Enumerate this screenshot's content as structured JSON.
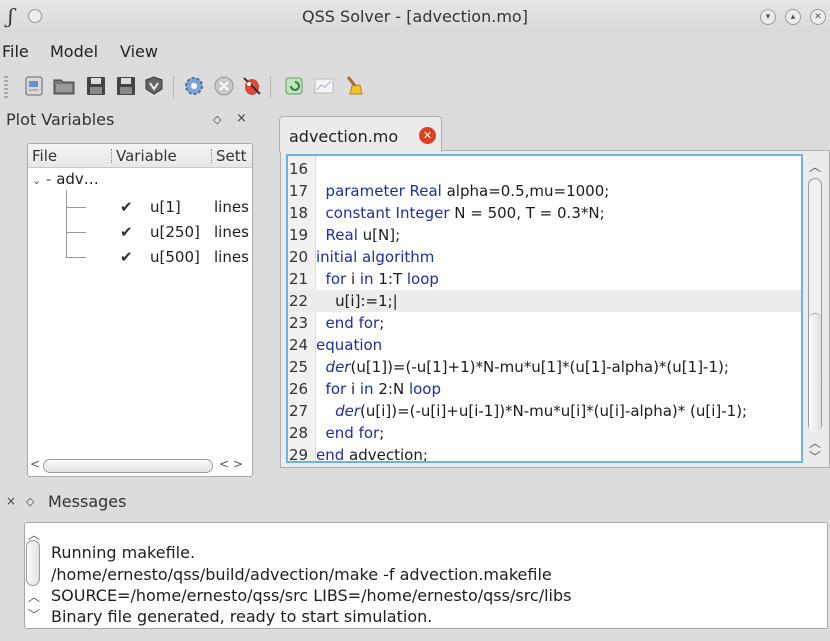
{
  "window": {
    "title": "QSS Solver - [advection.mo]",
    "app_glyph": "ʃ"
  },
  "menu": [
    "File",
    "Model",
    "View"
  ],
  "toolbar": {
    "buttons": [
      "new-file-icon",
      "open-folder-icon",
      "save-icon",
      "save-as-icon",
      "compile-icon",
      "settings-gear-icon",
      "stop-icon",
      "debug-icon",
      "run-icon",
      "plot-icon",
      "clear-broom-icon"
    ]
  },
  "plot_dock": {
    "title": "Plot Variables",
    "columns": [
      "File",
      "Variable",
      "Sett"
    ],
    "root_label": "adv…",
    "items": [
      {
        "variable": "u[1]",
        "setting": "lines"
      },
      {
        "variable": "u[250]",
        "setting": "lines"
      },
      {
        "variable": "u[500]",
        "setting": "lines"
      }
    ]
  },
  "editor": {
    "tab_label": "advection.mo",
    "lines": [
      {
        "n": "16",
        "parts": []
      },
      {
        "n": "17",
        "parts": [
          {
            "t": "  "
          },
          {
            "t": "parameter Real",
            "c": "kw"
          },
          {
            "t": " alpha=0.5,mu=1000;"
          }
        ]
      },
      {
        "n": "18",
        "parts": [
          {
            "t": "  "
          },
          {
            "t": "constant Integer",
            "c": "kw"
          },
          {
            "t": " N = 500, T = 0.3*N;"
          }
        ]
      },
      {
        "n": "19",
        "parts": [
          {
            "t": "  "
          },
          {
            "t": "Real",
            "c": "kw"
          },
          {
            "t": " u[N];"
          }
        ]
      },
      {
        "n": "20",
        "parts": [
          {
            "t": "initial algorithm",
            "c": "kw"
          }
        ]
      },
      {
        "n": "21",
        "parts": [
          {
            "t": "  "
          },
          {
            "t": "for",
            "c": "kw"
          },
          {
            "t": " i "
          },
          {
            "t": "in",
            "c": "kw"
          },
          {
            "t": " 1:T "
          },
          {
            "t": "loop",
            "c": "kw"
          }
        ]
      },
      {
        "n": "22",
        "parts": [
          {
            "t": "    u[i]:=1;|"
          }
        ],
        "current": true
      },
      {
        "n": "23",
        "parts": [
          {
            "t": "  "
          },
          {
            "t": "end for",
            "c": "kw"
          },
          {
            "t": ";"
          }
        ]
      },
      {
        "n": "24",
        "parts": [
          {
            "t": "equation",
            "c": "kw"
          }
        ]
      },
      {
        "n": "25",
        "parts": [
          {
            "t": "  "
          },
          {
            "t": "der",
            "c": "it"
          },
          {
            "t": "(u[1])=(-u[1]+1)*N-mu*u[1]*(u[1]-alpha)*(u[1]-1);"
          }
        ]
      },
      {
        "n": "26",
        "parts": [
          {
            "t": "  "
          },
          {
            "t": "for",
            "c": "kw"
          },
          {
            "t": " i "
          },
          {
            "t": "in",
            "c": "kw"
          },
          {
            "t": " 2:N "
          },
          {
            "t": "loop",
            "c": "kw"
          }
        ]
      },
      {
        "n": "27",
        "parts": [
          {
            "t": "    "
          },
          {
            "t": "der",
            "c": "it"
          },
          {
            "t": "(u[i])=(-u[i]+u[i-1])*N-mu*u[i]*(u[i]-alpha)* (u[i]-1);"
          }
        ]
      },
      {
        "n": "28",
        "parts": [
          {
            "t": "  "
          },
          {
            "t": "end for",
            "c": "kw"
          },
          {
            "t": ";"
          }
        ]
      },
      {
        "n": "29",
        "parts": [
          {
            "t": "end",
            "c": "kw"
          },
          {
            "t": " advection;"
          }
        ]
      }
    ]
  },
  "messages": {
    "title": "Messages",
    "lines": [
      "Running makefile.",
      "/home/ernesto/qss/build/advection/make -f advection.makefile",
      "SOURCE=/home/ernesto/qss/src LIBS=/home/ernesto/qss/src/libs",
      "Binary file generated, ready to start simulation."
    ]
  },
  "colors": {
    "keyword": "#1f2f9c",
    "editor_focus": "#6fb1e0",
    "tab_close": "#e04020"
  }
}
